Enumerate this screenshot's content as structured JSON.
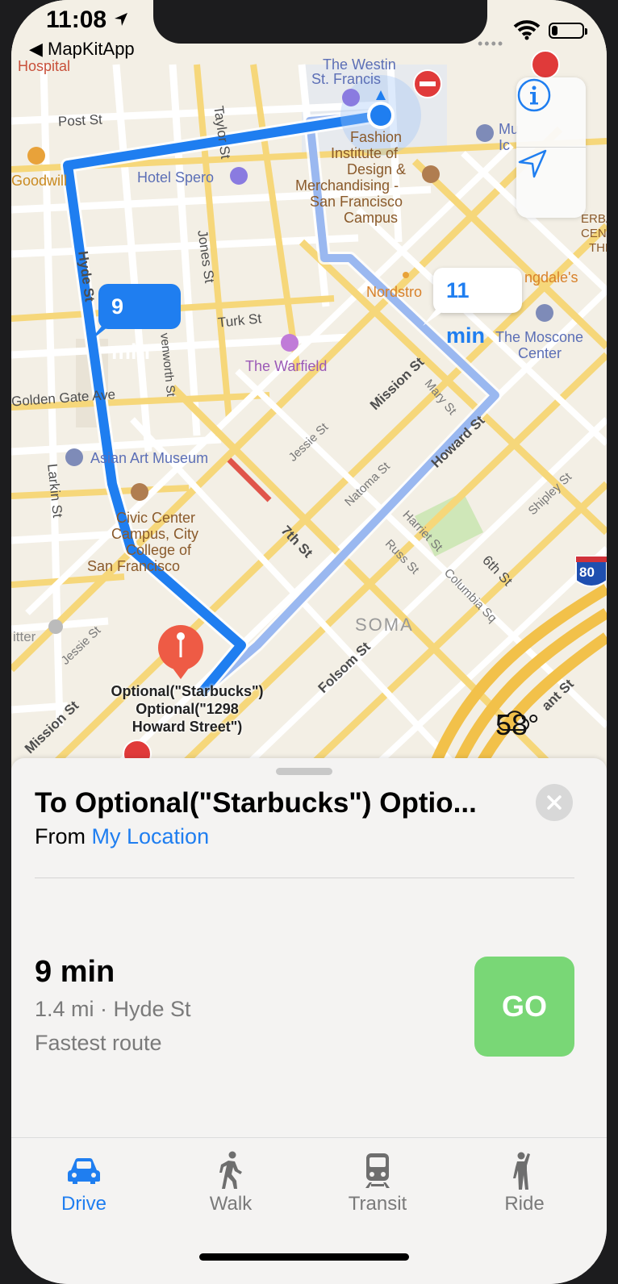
{
  "status_bar": {
    "time": "11:08",
    "back_app": "MapKitApp",
    "battery_level": 0.2
  },
  "map": {
    "streets": {
      "post": "Post St",
      "taylor": "Taylor St",
      "jones": "Jones St",
      "hyde": "Hyde St",
      "turk": "Turk St",
      "leavenworth": "venworth St",
      "golden_gate": "Golden Gate Ave",
      "larkin": "Larkin St",
      "jessie_1": "Jessie St",
      "jessie_2": "Jessie St",
      "mission_1": "Mission St",
      "mission_2": "Mission St",
      "mary": "Mary St",
      "howard": "Howard St",
      "natoma": "Natoma St",
      "seventh": "7th St",
      "harriet": "Harriet St",
      "russ": "Russ St",
      "columbia": "Columbia Sq",
      "sixth": "6th St",
      "shipley": "Shipley St",
      "folsom": "Folsom St",
      "bryant": "ant St"
    },
    "pois": {
      "hospital": "Hospital",
      "westin_1": "The Westin",
      "westin_2": "St. Francis",
      "fashion_1": "Fashion",
      "fashion_2": "Institute of",
      "fashion_3": "Design &",
      "fashion_4": "Merchandising -",
      "fashion_5": "San Francisco",
      "fashion_6": "Campus",
      "goodwill": "Goodwill",
      "hotel_spero": "Hotel Spero",
      "museum_partial_1": "Mu",
      "museum_partial_2": "Ic",
      "yerba_1": "ERBA",
      "yerba_2": "CENT",
      "yerba_3": "THE",
      "nordstrom": "Nordstro",
      "bloomingdales": "ngdale's",
      "moscone_1": "The Moscone",
      "moscone_2": "Center",
      "warfield": "The Warfield",
      "asian_art": "Asian Art Museum",
      "civic_1": "Civic Center",
      "civic_2": "Campus, City",
      "civic_3": "College of",
      "civic_4": "San Francisco",
      "twitter": "itter",
      "soma": "SOMA",
      "interstate": "80"
    },
    "callouts": {
      "primary": "9 min",
      "alternate": "11 min"
    },
    "destination_label": {
      "line1": "Optional(\"Starbucks\")",
      "line2": "Optional(\"1298",
      "line3": "Howard Street\")"
    },
    "weather": {
      "temp": "58°",
      "icon": "cloud-icon"
    },
    "colors": {
      "route_primary": "#1f7ef0",
      "route_alt": "#9ab8f0"
    }
  },
  "sheet": {
    "destination_title": "To Optional(\"Starbucks\") Optio...",
    "from_prefix": "From",
    "from_location": "My Location",
    "eta": "9 min",
    "route_desc": "1.4 mi · Hyde St",
    "route_note": "Fastest route",
    "go_label": "GO",
    "go_color": "#79d776"
  },
  "tabs": [
    {
      "label": "Drive",
      "icon": "car-icon",
      "active": true
    },
    {
      "label": "Walk",
      "icon": "walk-icon",
      "active": false
    },
    {
      "label": "Transit",
      "icon": "train-icon",
      "active": false
    },
    {
      "label": "Ride",
      "icon": "ride-icon",
      "active": false
    }
  ],
  "accent": "#1f7ef0"
}
